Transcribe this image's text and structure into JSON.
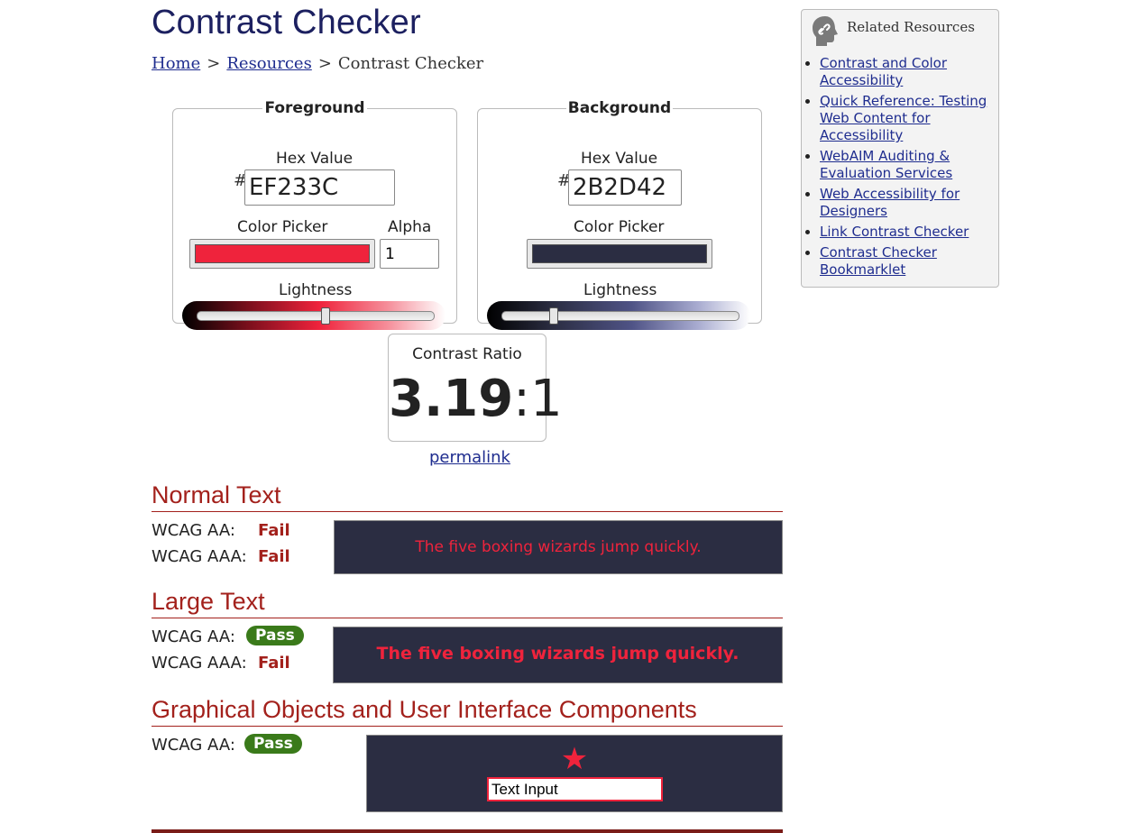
{
  "page": {
    "title": "Contrast Checker",
    "breadcrumb": {
      "home": "Home",
      "resources": "Resources",
      "current": "Contrast Checker",
      "separator": ">"
    }
  },
  "foreground": {
    "legend": "Foreground",
    "hex_label": "Hex Value",
    "hash": "#",
    "hex_value": "EF233C",
    "color_picker_label": "Color Picker",
    "alpha_label": "Alpha",
    "alpha_value": "1",
    "lightness_label": "Lightness",
    "lightness_level": 0.54,
    "color": "#EF233C"
  },
  "background": {
    "legend": "Background",
    "hex_label": "Hex Value",
    "hash": "#",
    "hex_value": "2B2D42",
    "color_picker_label": "Color Picker",
    "lightness_label": "Lightness",
    "lightness_level": 0.22,
    "color": "#2B2D42"
  },
  "contrast": {
    "label": "Contrast Ratio",
    "ratio": "3.19",
    "suffix": ":1",
    "permalink": "permalink"
  },
  "normal_text": {
    "heading": "Normal Text",
    "aa_label": "WCAG AA:",
    "aa_result": "Fail",
    "aaa_label": "WCAG AAA:",
    "aaa_result": "Fail",
    "sample": "The five boxing wizards jump quickly."
  },
  "large_text": {
    "heading": "Large Text",
    "aa_label": "WCAG AA:",
    "aa_result": "Pass",
    "aaa_label": "WCAG AAA:",
    "aaa_result": "Fail",
    "sample": "The five boxing wizards jump quickly."
  },
  "graphics": {
    "heading": "Graphical Objects and User Interface Components",
    "aa_label": "WCAG AA:",
    "aa_result": "Pass",
    "star_icon": "star-icon",
    "input_text": "Text Input"
  },
  "related": {
    "heading": "Related Resources",
    "icon": "link-head-icon",
    "links": [
      "Contrast and Color Accessibility",
      "Quick Reference: Testing Web Content for Accessibility",
      "WebAIM Auditing & Evaluation Services",
      "Web Accessibility for Designers",
      "Link Contrast Checker",
      "Contrast Checker Bookmarklet"
    ]
  },
  "colors": {
    "heading_red": "#a3211c",
    "pass_green": "#3a7a1a",
    "link_blue": "#1f2d8f",
    "title_navy": "#1c2060"
  }
}
